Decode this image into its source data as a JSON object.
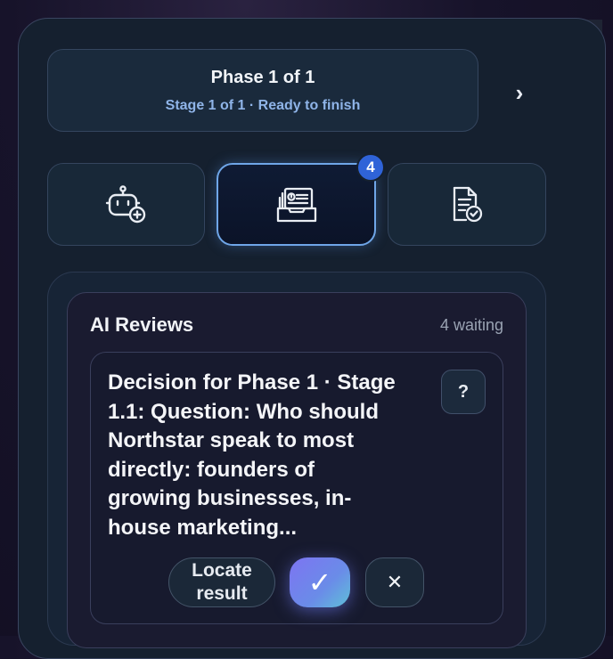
{
  "phase": {
    "title": "Phase 1 of 1",
    "subtitle": "Stage 1 of 1 · Ready to finish",
    "next_icon": "chevron-right-icon",
    "next_glyph": "›"
  },
  "toolbar": {
    "buttons": [
      {
        "icon": "ai-assistant-icon",
        "active": false
      },
      {
        "icon": "review-inbox-icon",
        "active": true,
        "badge": "4"
      },
      {
        "icon": "approved-document-icon",
        "active": false
      }
    ]
  },
  "reviews": {
    "title": "AI Reviews",
    "count_label": "4 waiting",
    "item": {
      "text": "Decision for Phase 1 · Stage 1.1: Question: Who should Northstar speak to most directly: founders of growing businesses, in-house marketing...",
      "help_label": "?",
      "locate_label": "Locate result",
      "approve_glyph": "✓",
      "reject_glyph": "✕"
    }
  },
  "colors": {
    "accent": "#2f63d8",
    "approve_gradient_start": "#7d74f2",
    "approve_gradient_end": "#5fc0d8",
    "subtitle": "#8fb4e8"
  }
}
